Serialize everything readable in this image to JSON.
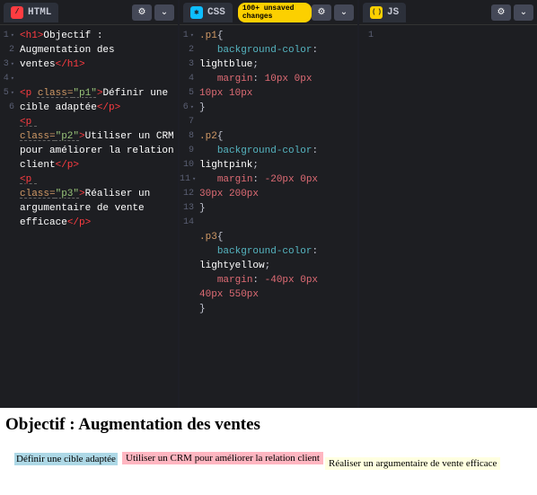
{
  "panels": {
    "html": {
      "label": "HTML"
    },
    "css": {
      "label": "CSS",
      "badge": "100+ unsaved changes"
    },
    "js": {
      "label": "JS"
    }
  },
  "icons": {
    "gear": "⚙",
    "chevron": "⌄"
  },
  "html_code": {
    "l1_open": "<h1>",
    "l1_text": "Objectif : Augmentation des ventes",
    "l1_close": "</h1>",
    "l3_open": "<p ",
    "l3_attr": "class=",
    "l3_val": "\"p1\"",
    "l3_gt": ">",
    "l3_text": "Définir une cible adaptée",
    "l3_close": "</p>",
    "l4_open": "<p ",
    "l4_attr": "class=",
    "l4_val": "\"p2\"",
    "l4_gt": ">",
    "l4_text": "Utiliser un CRM pour améliorer la relation client",
    "l4_close": "</p>",
    "l5_open": "<p ",
    "l5_attr": "class=",
    "l5_val": "\"p3\"",
    "l5_gt": ">",
    "l5_text": "Réaliser un argumentaire de vente efficace",
    "l5_close": "</p>"
  },
  "css_code": {
    "s1": ".p1",
    "ob": "{",
    "p_bg": "background-color",
    "colon": ": ",
    "v1_bg": "lightblue",
    "semi": ";",
    "p_mg": "margin",
    "v1_mg_a": "10px 0px",
    "v1_mg_b": "10px 10px",
    "cb": "}",
    "s2": ".p2",
    "v2_bg": "lightpink",
    "v2_mg_a": "-20px 0px",
    "v2_mg_b": "30px 200px",
    "s3": ".p3",
    "v3_bg": "lightyellow",
    "v3_mg_a": "-40px 0px",
    "v3_mg_b": "40px 550px"
  },
  "gutters": {
    "html": [
      "1",
      "",
      "",
      "2",
      "3",
      "",
      "4",
      "",
      "",
      "",
      "",
      "5",
      "",
      "",
      "",
      "6"
    ],
    "css": [
      "1",
      "2",
      "",
      "3",
      "",
      "4",
      "5",
      "6",
      "7",
      "",
      "8",
      "",
      "9",
      "10",
      "11",
      "12",
      "",
      "13",
      "",
      "14"
    ],
    "js": [
      "1"
    ]
  },
  "preview": {
    "heading": "Objectif : Augmentation des ventes",
    "p1": "Définir une cible adaptée",
    "p2": "Utiliser un CRM pour améliorer la relation client",
    "p3": "Réaliser un argumentaire de vente efficace"
  }
}
